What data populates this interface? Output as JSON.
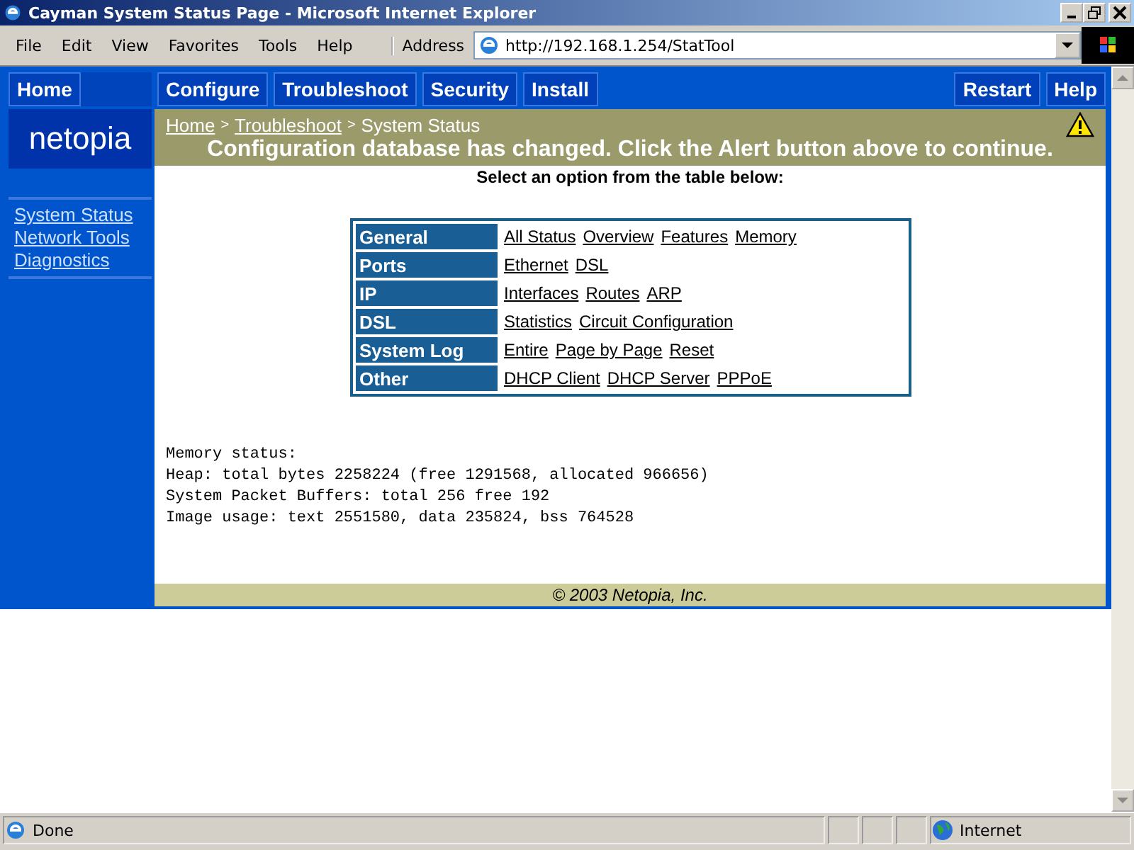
{
  "window": {
    "title": "Cayman System Status Page - Microsoft Internet Explorer"
  },
  "menu": [
    "File",
    "Edit",
    "View",
    "Favorites",
    "Tools",
    "Help"
  ],
  "address": {
    "label": "Address",
    "value": "http://192.168.1.254/StatTool"
  },
  "nav": {
    "home": "Home",
    "left": [
      "Configure",
      "Troubleshoot",
      "Security",
      "Install"
    ],
    "right": [
      "Restart",
      "Help"
    ]
  },
  "logo": "netopia",
  "sidebar": {
    "links": [
      "System Status",
      "Network Tools",
      "Diagnostics"
    ]
  },
  "breadcrumb": {
    "separator": ">",
    "items": [
      {
        "text": "Home",
        "kind": "link"
      },
      {
        "text": "Troubleshoot",
        "kind": "link"
      },
      {
        "text": "System Status",
        "kind": "current"
      }
    ]
  },
  "alert": "Configuration database has changed. Click the Alert button above to continue.",
  "instruction": "Select an option from the table below:",
  "options": [
    {
      "category": "General",
      "links": [
        "All Status",
        "Overview",
        "Features",
        "Memory"
      ]
    },
    {
      "category": "Ports",
      "links": [
        "Ethernet",
        "DSL"
      ]
    },
    {
      "category": "IP",
      "links": [
        "Interfaces",
        "Routes",
        "ARP"
      ]
    },
    {
      "category": "DSL",
      "links": [
        "Statistics",
        "Circuit Configuration"
      ]
    },
    {
      "category": "System Log",
      "links": [
        "Entire",
        "Page by Page",
        "Reset"
      ]
    },
    {
      "category": "Other",
      "links": [
        "DHCP Client",
        "DHCP Server",
        "PPPoE"
      ]
    }
  ],
  "output": [
    "Memory status:",
    "Heap: total bytes 2258224 (free 1291568, allocated 966656)",
    "System Packet Buffers: total 256 free 192",
    "Image usage: text 2551580, data 235824, bss 764528"
  ],
  "footer": "© 2003 Netopia, Inc.",
  "status_bar": {
    "text": "Done",
    "zone": "Internet"
  }
}
